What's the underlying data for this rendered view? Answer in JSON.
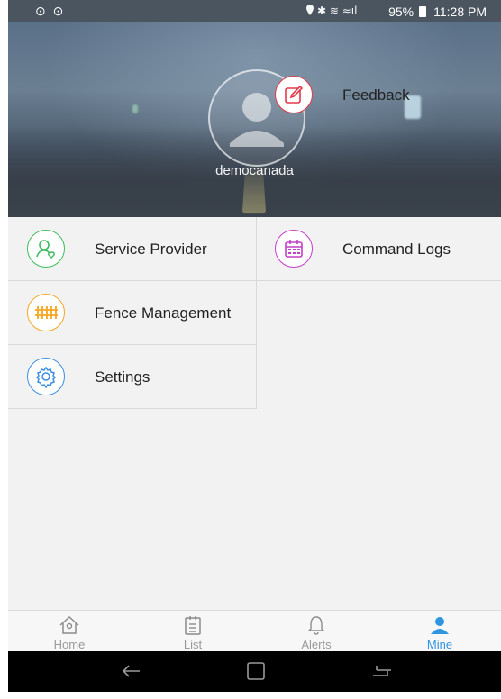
{
  "status_bar": {
    "left_icons": "⊙ ⊙",
    "battery": "95%",
    "time": "11:28 PM"
  },
  "profile": {
    "username": "democanada"
  },
  "menu": {
    "left": [
      {
        "label": "Service Provider",
        "icon": "user-heart-icon",
        "color": "#3dbb5f"
      },
      {
        "label": "Fence Management",
        "icon": "fence-icon",
        "color": "#f5a623"
      },
      {
        "label": "Settings",
        "icon": "gear-icon",
        "color": "#3b8fe0"
      }
    ],
    "right": [
      {
        "label": "Command Logs",
        "icon": "calendar-icon",
        "color": "#c040c8"
      },
      {
        "label": "Feedback",
        "icon": "edit-icon",
        "color": "#e23a4a"
      }
    ]
  },
  "tabs": [
    {
      "label": "Home",
      "icon": "home-icon"
    },
    {
      "label": "List",
      "icon": "list-icon"
    },
    {
      "label": "Alerts",
      "icon": "bell-icon"
    },
    {
      "label": "Mine",
      "icon": "person-icon",
      "active": true
    }
  ],
  "colors": {
    "accent": "#2f95e0",
    "inactive": "#9a9a9a"
  }
}
